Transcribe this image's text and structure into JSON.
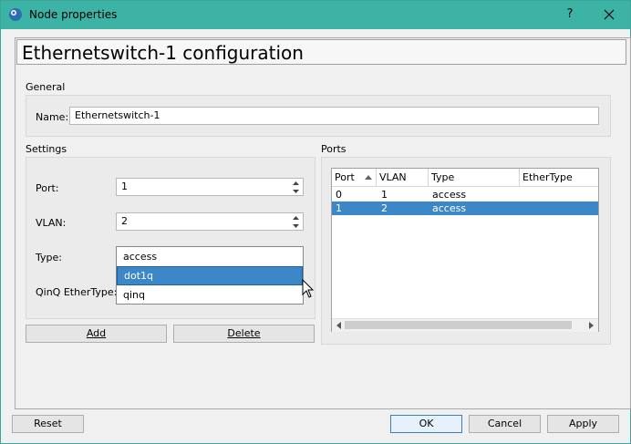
{
  "window": {
    "title": "Node properties",
    "help_label": "?",
    "close_label": "✕"
  },
  "header": {
    "title": "Ethernetswitch-1 configuration"
  },
  "general": {
    "group_label": "General",
    "name_label": "Name:",
    "name_value": "Ethernetswitch-1"
  },
  "settings": {
    "group_label": "Settings",
    "port_label": "Port:",
    "port_value": "1",
    "vlan_label": "VLAN:",
    "vlan_value": "2",
    "type_label": "Type:",
    "qinq_label": "QinQ EtherType:",
    "type_options": [
      "access",
      "dot1q",
      "qinq"
    ],
    "type_highlighted": "dot1q",
    "add_label": "Add",
    "delete_label": "Delete"
  },
  "ports": {
    "group_label": "Ports",
    "columns": [
      "Port",
      "VLAN",
      "Type",
      "EtherType"
    ],
    "rows": [
      {
        "port": "0",
        "vlan": "1",
        "type": "access",
        "ethertype": ""
      },
      {
        "port": "1",
        "vlan": "2",
        "type": "access",
        "ethertype": ""
      }
    ],
    "selected_row": 1
  },
  "footer": {
    "reset_label": "Reset",
    "ok_label": "OK",
    "cancel_label": "Cancel",
    "apply_label": "Apply"
  },
  "colors": {
    "titlebar": "#3cb3a4",
    "selection": "#3c87c8"
  }
}
